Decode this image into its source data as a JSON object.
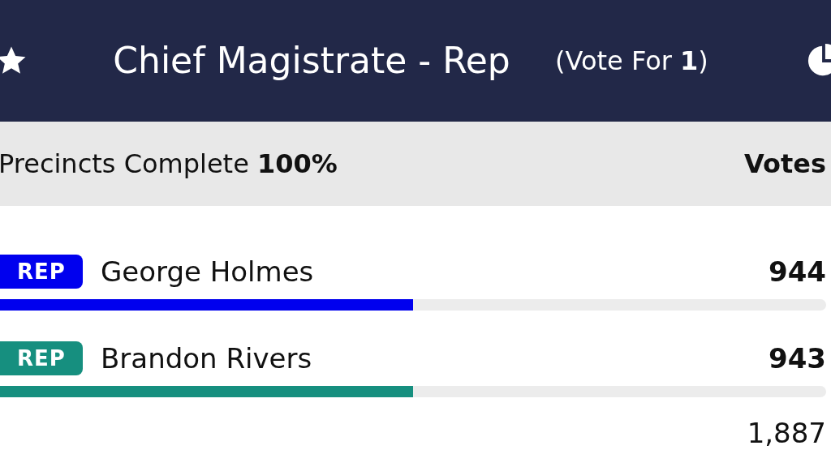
{
  "header": {
    "title": "Chief Magistrate - Rep",
    "vote_for": "(Vote For **1**)"
  },
  "summary": {
    "precincts_label": "Precincts Complete **100%**",
    "votes_heading": "Votes"
  },
  "candidates": [
    {
      "party": "REP",
      "name": "George Holmes",
      "votes": "944",
      "level": 0.5,
      "color": "#0000ee"
    },
    {
      "party": "REP",
      "name": "Brandon Rivers",
      "votes": "943",
      "level": 0.5,
      "color": "#168f7f"
    }
  ],
  "total": "1,887"
}
